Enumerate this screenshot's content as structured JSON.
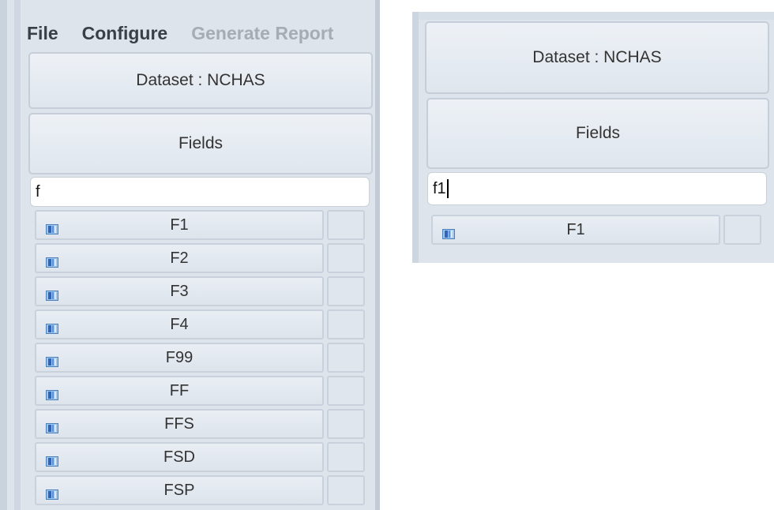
{
  "menu": {
    "file": "File",
    "configure": "Configure",
    "generate_report": "Generate Report"
  },
  "left_panel": {
    "dataset_label": "Dataset : NCHAS",
    "fields_label": "Fields",
    "search_value": "f",
    "fields": [
      "F1",
      "F2",
      "F3",
      "F4",
      "F99",
      "FF",
      "FFS",
      "FSD",
      "FSP"
    ]
  },
  "right_panel": {
    "dataset_label": "Dataset : NCHAS",
    "fields_label": "Fields",
    "search_value": "f1",
    "fields": [
      "F1"
    ]
  },
  "icons": {
    "field_row": "field-column-icon"
  },
  "colors": {
    "panel_bg": "#dde4ec",
    "border": "#c5ced9",
    "icon_blue": "#3f7fd3"
  }
}
